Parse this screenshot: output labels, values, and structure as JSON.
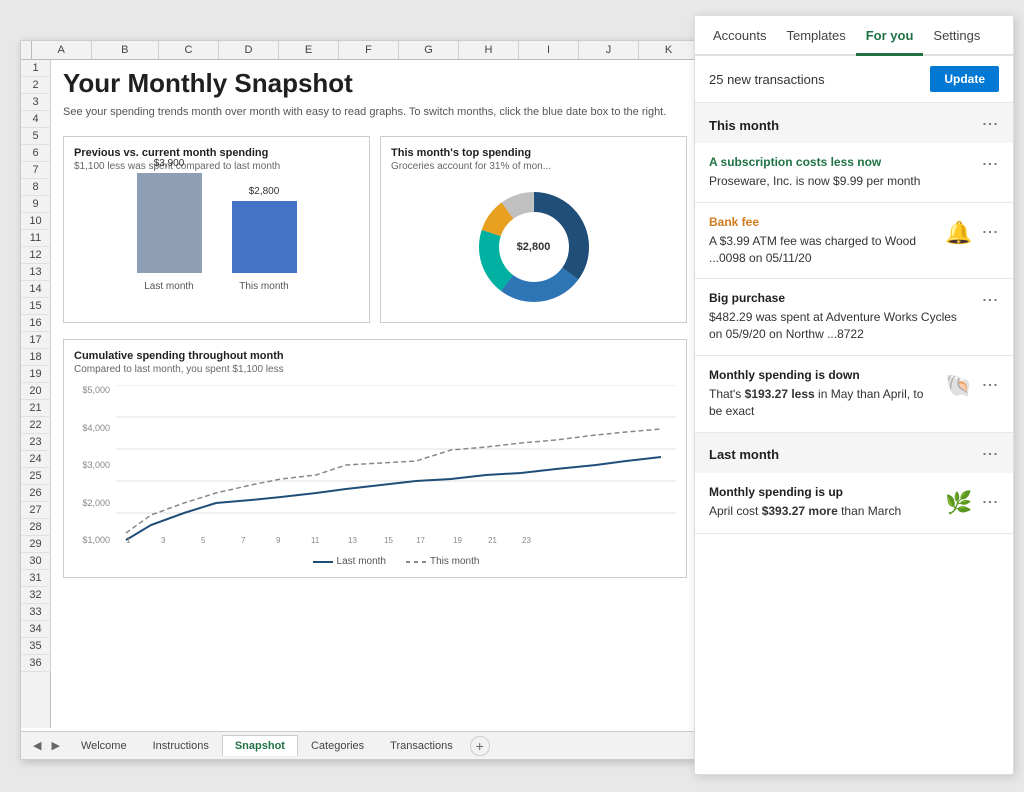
{
  "excel": {
    "col_headers": [
      "A",
      "B",
      "C",
      "D",
      "E",
      "F",
      "G",
      "H",
      "I",
      "J",
      "K"
    ],
    "title": "Your Monthly Snapshot",
    "subtitle": "See your spending trends month over month with easy to read graphs. To switch months, click the blue date box to the right.",
    "bar_chart": {
      "title": "Previous vs. current month spending",
      "subtitle": "$1,100 less was spent compared to last month",
      "last_month_value": "$3,900",
      "this_month_value": "$2,800",
      "last_month_label": "Last month",
      "this_month_label": "This month"
    },
    "donut_chart": {
      "title": "This month's top spending",
      "subtitle": "Groceries account for 31% of mon...",
      "center_label": "$2,800"
    },
    "cumulative_chart": {
      "title": "Cumulative spending throughout month",
      "subtitle": "Compared to last month, you spent $1,100 less",
      "y_labels": [
        "$5,000",
        "$4,000",
        "$3,000",
        "$2,000",
        "$1,000"
      ],
      "x_labels": [
        "1",
        "3",
        "5",
        "7",
        "9",
        "11",
        "13",
        "15",
        "17",
        "19",
        "21",
        "23"
      ],
      "legend_last": "Last month",
      "legend_this": "This month"
    },
    "tabs": [
      {
        "label": "Welcome",
        "active": false
      },
      {
        "label": "Instructions",
        "active": false
      },
      {
        "label": "Snapshot",
        "active": true
      },
      {
        "label": "Categories",
        "active": false
      },
      {
        "label": "Transactions",
        "active": false
      }
    ]
  },
  "panel": {
    "nav": [
      {
        "label": "Accounts",
        "active": false
      },
      {
        "label": "Templates",
        "active": false
      },
      {
        "label": "For you",
        "active": true
      },
      {
        "label": "Settings",
        "active": false
      }
    ],
    "notification": {
      "text": "25 new transactions",
      "button": "Update"
    },
    "sections": [
      {
        "title": "This month",
        "cards": [
          {
            "category": "A subscription costs less now",
            "category_color": "green",
            "description": "Proseware, Inc. is now $9.99 per month",
            "icon": ""
          },
          {
            "category": "Bank fee",
            "category_color": "orange",
            "description": "A $3.99 ATM fee was charged to Wood ...0098 on 05/11/20",
            "icon": "🔔"
          },
          {
            "category": "Big purchase",
            "category_color": "black",
            "description": "$482.29 was spent at Adventure Works Cycles on 05/9/20 on Northw ...8722",
            "icon": ""
          },
          {
            "category": "Monthly spending is down",
            "category_color": "black",
            "description": "That's $193.27 less in May than April, to be exact",
            "icon": "🐚"
          }
        ]
      },
      {
        "title": "Last month",
        "cards": [
          {
            "category": "Monthly spending is up",
            "category_color": "black",
            "description": "April cost $393.27 more than March",
            "icon": "🌿"
          }
        ]
      }
    ]
  }
}
